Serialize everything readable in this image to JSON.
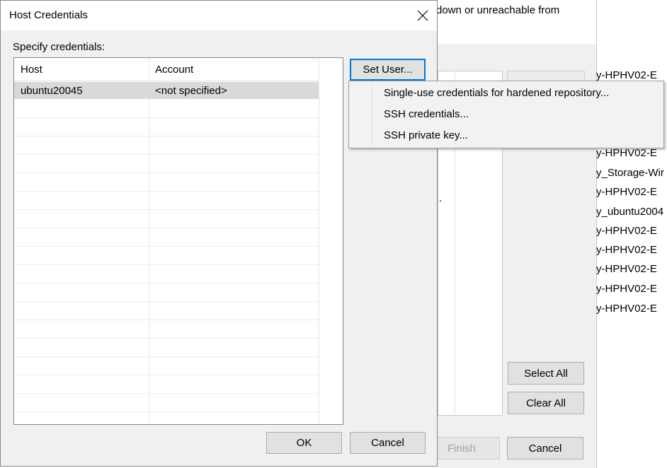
{
  "background": {
    "header_text": "down or unreachable from",
    "buttons": {
      "select_all": "Select All",
      "clear_all": "Clear All",
      "finish": "Finish",
      "cancel": "Cancel"
    },
    "list_dot": ".",
    "host_fragments": [
      "y-HPHV02-E",
      "y-HPHV02-E",
      "y_Storage-Wir",
      "y-HPHV02-E",
      "y_ubuntu2004",
      "y-HPHV02-E",
      "y-HPHV02-E",
      "y-HPHV02-E",
      "y-HPHV02-E",
      "y-HPHV02-E"
    ]
  },
  "dialog": {
    "title": "Host Credentials",
    "close_icon": "close-icon",
    "label": "Specify credentials:",
    "columns": [
      "Host",
      "Account"
    ],
    "rows": [
      {
        "host": "ubuntu20045",
        "account": "<not specified>"
      }
    ],
    "set_user_button": "Set User...",
    "ok_button": "OK",
    "cancel_button": "Cancel"
  },
  "menu": {
    "items": [
      "Single-use credentials for hardened repository...",
      "SSH credentials...",
      "SSH private key..."
    ]
  }
}
